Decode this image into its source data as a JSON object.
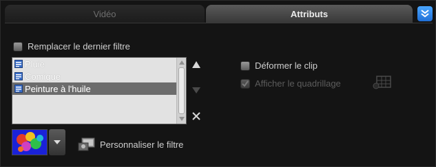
{
  "tabs": [
    {
      "label": "Vidéo",
      "active": false
    },
    {
      "label": "Attributs",
      "active": true
    }
  ],
  "collapse_button_icon": "double-chevron-down-icon",
  "replace_last_filter": {
    "label": "Remplacer le dernier filtre",
    "checked": false
  },
  "filter_list": {
    "items": [
      {
        "label": "Pluie",
        "selected": false
      },
      {
        "label": "Comique",
        "selected": false
      },
      {
        "label": "Peinture à l'huile",
        "selected": true
      }
    ]
  },
  "list_buttons": {
    "move_up_icon": "triangle-up-icon",
    "move_down_icon": "triangle-down-icon",
    "remove_icon": "close-x-icon"
  },
  "deform_clip": {
    "label": "Déformer le clip",
    "checked": false
  },
  "show_grid": {
    "label": "Afficher le quadrillage",
    "checked": true,
    "enabled": false
  },
  "customize_filter": {
    "label": "Personnaliser le filtre"
  },
  "colors": {
    "accent": "#2a8cf0",
    "selection": "#6c6c6c",
    "list_bg": "#e2e2e2",
    "panel_bg": "#141414"
  }
}
